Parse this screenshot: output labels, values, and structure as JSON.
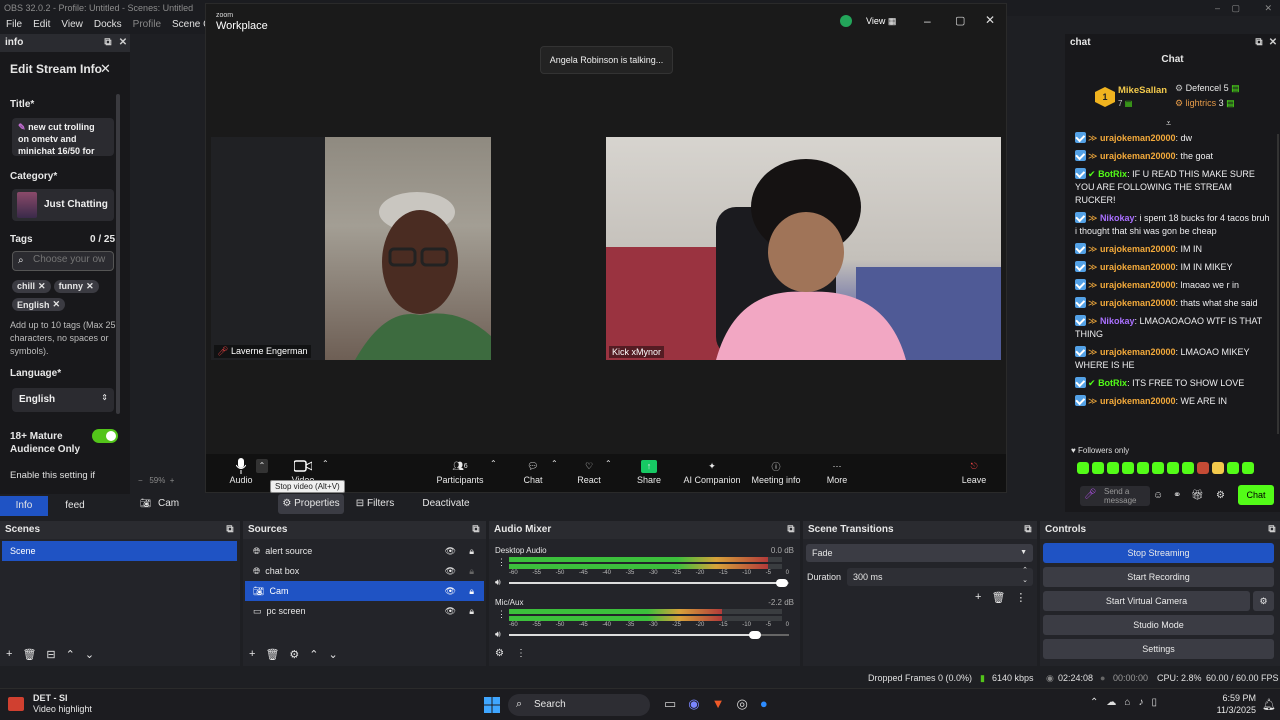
{
  "obs": {
    "title": "OBS 32.0.2 - Profile: Untitled - Scenes: Untitled",
    "menu": [
      "File",
      "Edit",
      "View",
      "Docks",
      "Profile",
      "Scene Collecti"
    ],
    "zoom_pct": "59%"
  },
  "info": {
    "dock_title": "info",
    "heading": "Edit Stream Info",
    "title_label": "Title*",
    "title_value": "new cut trolling on ometv and minichat 16/50 for",
    "category_label": "Category*",
    "category_value": "Just Chatting",
    "tags_label": "Tags",
    "tags_count": "0 / 25",
    "tags_placeholder": "Choose your ow",
    "tags": [
      "chill",
      "funny",
      "English"
    ],
    "tags_help": "Add up to 10 tags (Max 25 characters, no spaces or symbols).",
    "language_label": "Language*",
    "language_value": "English",
    "mature_label": "18+ Mature Audience Only",
    "enable_label": "Enable this setting if",
    "tabs": [
      "Info",
      "feed"
    ]
  },
  "zoom": {
    "brand_small": "zoom",
    "brand_big": "Workplace",
    "view_label": "View",
    "talking": "Angela Robinson is talking...",
    "participants": [
      {
        "name": "Laverne Engerman"
      },
      {
        "name": "Kick xMynor"
      }
    ],
    "participants_count": "6",
    "toolbar": [
      "Audio",
      "Video",
      "Participants",
      "Chat",
      "React",
      "Share",
      "AI Companion",
      "Meeting info",
      "More",
      "Leave"
    ],
    "tooltip": "Stop video (Alt+V)"
  },
  "chat": {
    "dock_title": "chat",
    "header": "Chat",
    "leaders": [
      {
        "rank": "1",
        "name": "MikeSallan",
        "count": "7"
      },
      {
        "name": "Defencel",
        "count": "5"
      },
      {
        "name": "lightrics",
        "count": "3"
      }
    ],
    "messages": [
      {
        "user": "urajokeman20000",
        "text": "dw",
        "color": "#f2a93b"
      },
      {
        "user": "urajokeman20000",
        "text": "the goat",
        "color": "#f2a93b"
      },
      {
        "user": "BotRix",
        "text": "IF U READ THIS MAKE SURE YOU ARE FOLLOWING THE STREAM RUCKER!",
        "color": "#53fc18"
      },
      {
        "user": "Nikokay",
        "text": "i spent 18 bucks for 4 tacos bruh i thought that shi was gon be cheap",
        "color": "#a970ff"
      },
      {
        "user": "urajokeman20000",
        "text": "IM IN",
        "color": "#f2a93b"
      },
      {
        "user": "urajokeman20000",
        "text": "IM IN MIKEY",
        "color": "#f2a93b"
      },
      {
        "user": "urajokeman20000",
        "text": "lmaoao we r in",
        "color": "#f2a93b"
      },
      {
        "user": "urajokeman20000",
        "text": "thats what she said",
        "color": "#f2a93b"
      },
      {
        "user": "Nikokay",
        "text": "LMAOAOAOAO WTF IS THAT THING",
        "color": "#a970ff"
      },
      {
        "user": "urajokeman20000",
        "text": "LMAOAO MIKEY WHERE IS HE",
        "color": "#f2a93b"
      },
      {
        "user": "BotRix",
        "text": "ITS FREE TO SHOW LOVE",
        "color": "#53fc18"
      },
      {
        "user": "urajokeman20000",
        "text": "WE ARE IN",
        "color": "#f2a93b"
      }
    ],
    "followers_only": "Followers only",
    "input_placeholder": "Send a message",
    "send_label": "Chat"
  },
  "source_bar": {
    "selected": "Cam",
    "properties": "Properties",
    "filters": "Filters",
    "deactivate": "Deactivate"
  },
  "scenes": {
    "title": "Scenes",
    "items": [
      "Scene"
    ]
  },
  "sources": {
    "title": "Sources",
    "items": [
      "alert source",
      "chat box",
      "Cam",
      "pc screen"
    ],
    "selected": 2
  },
  "mixer": {
    "title": "Audio Mixer",
    "channels": [
      {
        "name": "Desktop Audio",
        "db": "0.0 dB",
        "level": 0.95,
        "volume": 1.0
      },
      {
        "name": "Mic/Aux",
        "db": "-2.2 dB",
        "level": 0.78,
        "volume": 0.9
      }
    ],
    "scale": [
      "-60",
      "-55",
      "-50",
      "-45",
      "-40",
      "-35",
      "-30",
      "-25",
      "-20",
      "-15",
      "-10",
      "-5",
      "0"
    ]
  },
  "transitions": {
    "title": "Scene Transitions",
    "type": "Fade",
    "duration_label": "Duration",
    "duration": "300 ms"
  },
  "controls": {
    "title": "Controls",
    "buttons": [
      "Stop Streaming",
      "Start Recording",
      "Start Virtual Camera",
      "Studio Mode",
      "Settings"
    ]
  },
  "status": {
    "dropped": "Dropped Frames 0 (0.0%)",
    "bitrate": "6140 kbps",
    "stream_time": "02:24:08",
    "rec_time": "00:00:00",
    "cpu": "CPU: 2.8%",
    "fps": "60.00 / 60.00 FPS"
  },
  "taskbar": {
    "app_name": "DET - SI",
    "app_sub": "Video highlight",
    "search": "Search",
    "time": "6:59 PM",
    "date": "11/3/2025"
  },
  "colors": {
    "accent": "#1f53c4",
    "kick_green": "#53fc18",
    "zoom_bar": "#111111"
  }
}
